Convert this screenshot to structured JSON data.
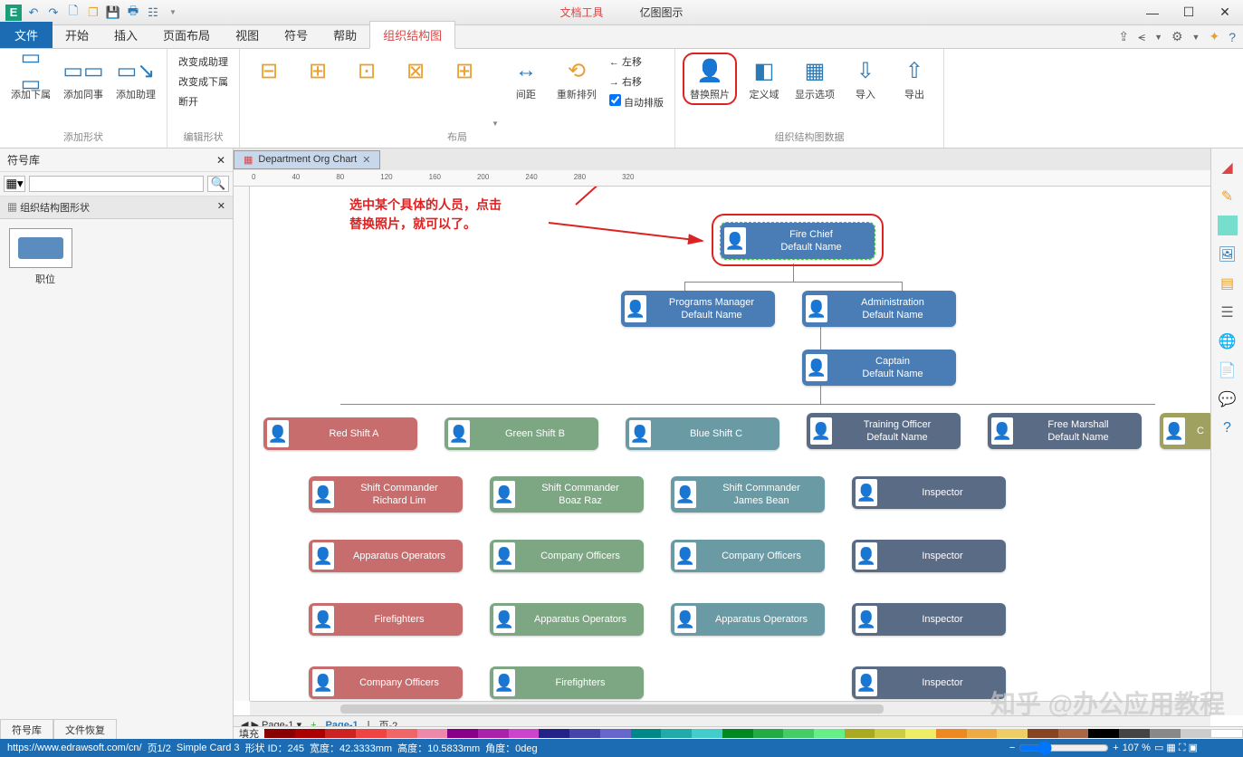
{
  "app_title": "亿图图示",
  "doc_tools": "文档工具",
  "tabs": {
    "file": "文件",
    "start": "开始",
    "insert": "插入",
    "layout": "页面布局",
    "view": "视图",
    "symbol": "符号",
    "help": "帮助",
    "orgchart": "组织结构图"
  },
  "ribbon": {
    "add_sub": "添加下属",
    "add_peer": "添加同事",
    "add_asst": "添加助理",
    "group_addshape": "添加形状",
    "to_asst": "改变成助理",
    "to_sub": "改变成下属",
    "disconnect": "断开",
    "group_editshape": "编辑形状",
    "spacing": "间距",
    "rearrange": "重新排列",
    "move_left": "左移",
    "move_right": "右移",
    "auto_layout": "自动排版",
    "group_layout": "布局",
    "replace_photo": "替换照片",
    "define": "定义域",
    "display_opts": "显示选项",
    "import": "导入",
    "export": "导出",
    "group_data": "组织结构图数据"
  },
  "sidebar": {
    "title": "符号库",
    "shapes_header": "组织结构图形状",
    "shape_label": "职位",
    "bottom_tab1": "符号库",
    "bottom_tab2": "文件恢复"
  },
  "doc_tab": "Department Org Chart",
  "annotation_l1": "选中某个具体的人员，点击",
  "annotation_l2": "替换照片，就可以了。",
  "nodes": {
    "root_t": "Fire Chief",
    "root_s": "Default Name",
    "pm_t": "Programs Manager",
    "pm_s": "Default Name",
    "admin_t": "Administration",
    "admin_s": "Default Name",
    "cap_t": "Captain",
    "cap_s": "Default Name",
    "red_t": "Red Shift A",
    "green_t": "Green Shift B",
    "blue_t": "Blue Shift C",
    "train_t": "Training Officer",
    "train_s": "Default Name",
    "free_t": "Free Marshall",
    "free_s": "Default Name",
    "sc1_t": "Shift Commander",
    "sc1_s": "Richard Lim",
    "sc2_t": "Shift Commander",
    "sc2_s": "Boaz Raz",
    "sc3_t": "Shift Commander",
    "sc3_s": "James Bean",
    "app_ops": "Apparatus Operators",
    "comp_off": "Company Officers",
    "firefighters": "Firefighters",
    "inspector": "Inspector"
  },
  "pages": {
    "sheet": "Page-1",
    "p1": "Page-1",
    "p2": "页-2"
  },
  "status": {
    "url": "https://www.edrawsoft.com/cn/",
    "page": "页1/2",
    "card": "Simple Card 3",
    "shape_id": "形状 ID：245",
    "width": "宽度：42.3333mm",
    "height": "高度：10.5833mm",
    "angle": "角度：0deg",
    "fill": "填充",
    "zoom": "107 %"
  },
  "watermark": "知乎 @办公应用教程"
}
